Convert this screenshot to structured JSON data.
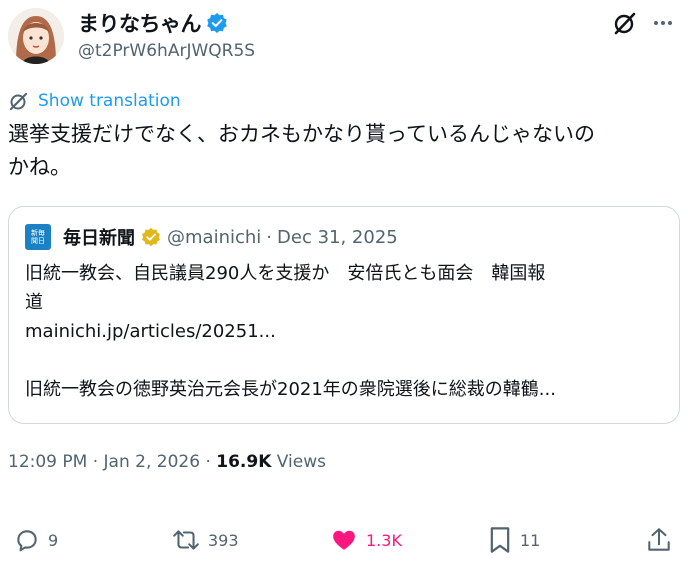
{
  "author": {
    "display_name": "まりなちゃん",
    "handle": "@t2PrW6hArJWQR5S",
    "verified_color": "#1d9bf0"
  },
  "translate": {
    "label": "Show translation",
    "icon": "translate-icon"
  },
  "tweet": {
    "lines": [
      "選挙支援だけでなく、おカネもかなり貰っているんじゃないの",
      "かね。"
    ]
  },
  "quote": {
    "name": "毎日新聞",
    "logo_text": "新毎\n聞日",
    "handle": "@mainichi",
    "separator": "·",
    "date": "Dec 31, 2025",
    "lines": [
      "旧統一教会、自民議員290人を支援か　安倍氏とも面会　韓国報",
      "道",
      "mainichi.jp/articles/20251...",
      "",
      "旧統一教会の徳野英治元会長が2021年の衆院選後に総裁の韓鶴..."
    ],
    "gold_check_color": "#e2b719"
  },
  "meta": {
    "time": "12:09 PM",
    "dot1": "·",
    "date": "Jan 2, 2026",
    "dot2": "·",
    "views_count": "16.9K",
    "views_label": "Views"
  },
  "actions": {
    "reply_count": "9",
    "repost_count": "393",
    "like_count": "1.3K",
    "bookmark_count": "11",
    "like_color": "#f91880"
  }
}
